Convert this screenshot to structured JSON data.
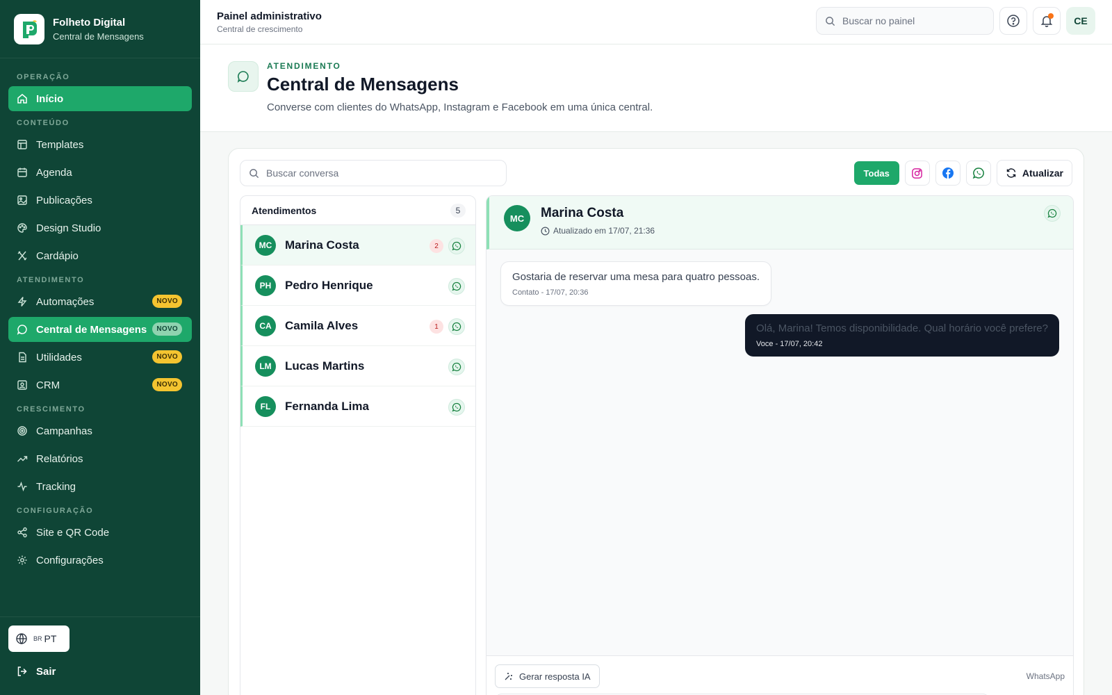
{
  "brand": {
    "title": "Folheto Digital",
    "subtitle": "Central de Mensagens"
  },
  "sidebar": {
    "sections": [
      {
        "label": "OPERAÇÃO"
      },
      {
        "label": "CONTEÚDO"
      },
      {
        "label": "ATENDIMENTO"
      },
      {
        "label": "CRESCIMENTO"
      },
      {
        "label": "CONFIGURAÇÃO"
      }
    ],
    "items": [
      {
        "label": "Início"
      },
      {
        "label": "Templates"
      },
      {
        "label": "Agenda"
      },
      {
        "label": "Publicações"
      },
      {
        "label": "Design Studio"
      },
      {
        "label": "Cardápio"
      },
      {
        "label": "Automações",
        "badge": "NOVO"
      },
      {
        "label": "Central de Mensagens",
        "badge": "NOVO"
      },
      {
        "label": "Utilidades",
        "badge": "NOVO"
      },
      {
        "label": "CRM",
        "badge": "NOVO"
      },
      {
        "label": "Campanhas"
      },
      {
        "label": "Relatórios"
      },
      {
        "label": "Tracking"
      },
      {
        "label": "Site e QR Code"
      },
      {
        "label": "Configurações"
      }
    ],
    "language": {
      "flag": "BR",
      "code": "PT"
    },
    "logout": "Sair"
  },
  "topbar": {
    "title": "Painel administrativo",
    "subtitle": "Central de crescimento",
    "search_placeholder": "Buscar no painel",
    "avatar": "CE"
  },
  "page": {
    "eyebrow": "ATENDIMENTO",
    "title": "Central de Mensagens",
    "description": "Converse com clientes do WhatsApp, Instagram e Facebook em uma única central."
  },
  "toolbar": {
    "search_placeholder": "Buscar conversa",
    "filter_all": "Todas",
    "refresh": "Atualizar"
  },
  "conversations": {
    "header": "Atendimentos",
    "count": "5",
    "items": [
      {
        "initials": "MC",
        "name": "Marina Costa",
        "unread": "2"
      },
      {
        "initials": "PH",
        "name": "Pedro Henrique"
      },
      {
        "initials": "CA",
        "name": "Camila Alves",
        "unread": "1"
      },
      {
        "initials": "LM",
        "name": "Lucas Martins"
      },
      {
        "initials": "FL",
        "name": "Fernanda Lima"
      }
    ]
  },
  "chat": {
    "initials": "MC",
    "name": "Marina Costa",
    "updated": "Atualizado em 17/07, 21:36",
    "messages": [
      {
        "text": "Gostaria de reservar uma mesa para quatro pessoas.",
        "meta": "Contato - 17/07, 20:36"
      },
      {
        "text": "Olá, Marina! Temos disponibilidade. Qual horário você prefere?",
        "meta": "Voce - 17/07, 20:42"
      }
    ],
    "ai_button": "Gerar resposta IA",
    "channel": "WhatsApp"
  },
  "colors": {
    "sidebar_bg": "#0f4536",
    "accent": "#1ea86a",
    "badge_novo": "#f4c430",
    "outgoing_bubble": "#111827"
  }
}
